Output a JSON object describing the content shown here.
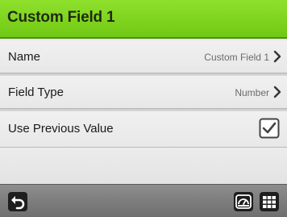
{
  "header": {
    "title": "Custom Field 1"
  },
  "rows": [
    {
      "label": "Name",
      "value": "Custom Field 1",
      "icon": "chevron-right-icon"
    },
    {
      "label": "Field Type",
      "value": "Number",
      "icon": "chevron-right-icon"
    },
    {
      "label": "Use Previous Value",
      "checked": true,
      "icon": "checkbox-checked-icon"
    }
  ],
  "footer": {
    "buttons": [
      "back-arrow-icon",
      "gauge-icon",
      "grid-icon"
    ]
  },
  "colors": {
    "header_green": "#7ed321",
    "footer_gray": "#7a7a7a",
    "button_dark": "#1e1e1e"
  }
}
